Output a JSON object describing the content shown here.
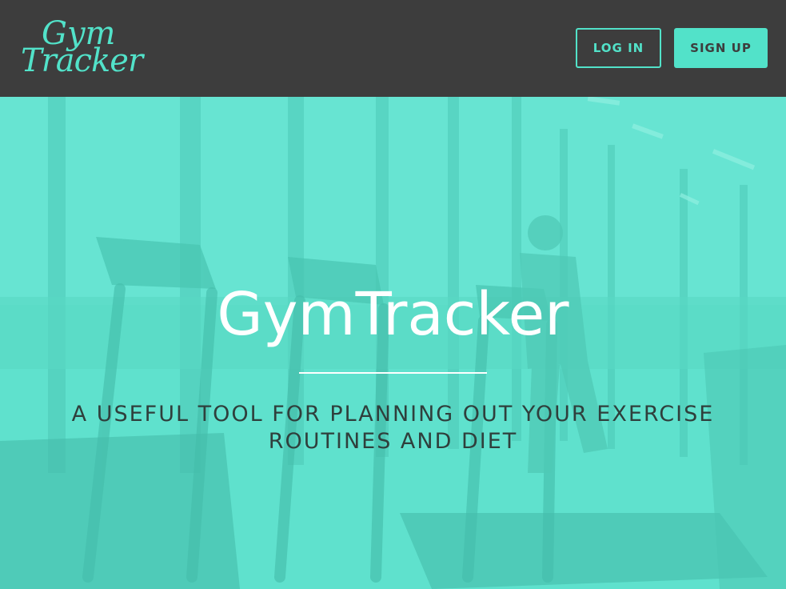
{
  "header": {
    "logo": {
      "line1": "Gym",
      "line2": "Tracker"
    },
    "login_label": "LOG IN",
    "signup_label": "SIGN UP"
  },
  "hero": {
    "title": "GymTracker",
    "subtitle": "A USEFUL TOOL FOR PLANNING OUT YOUR EXERCISE ROUTINES AND DIET"
  },
  "colors": {
    "header_bg": "#3d3d3d",
    "accent": "#52e2c9",
    "hero_overlay": "#5ce0cc",
    "title_text": "#ffffff",
    "subtitle_text": "#2f3f3c"
  }
}
